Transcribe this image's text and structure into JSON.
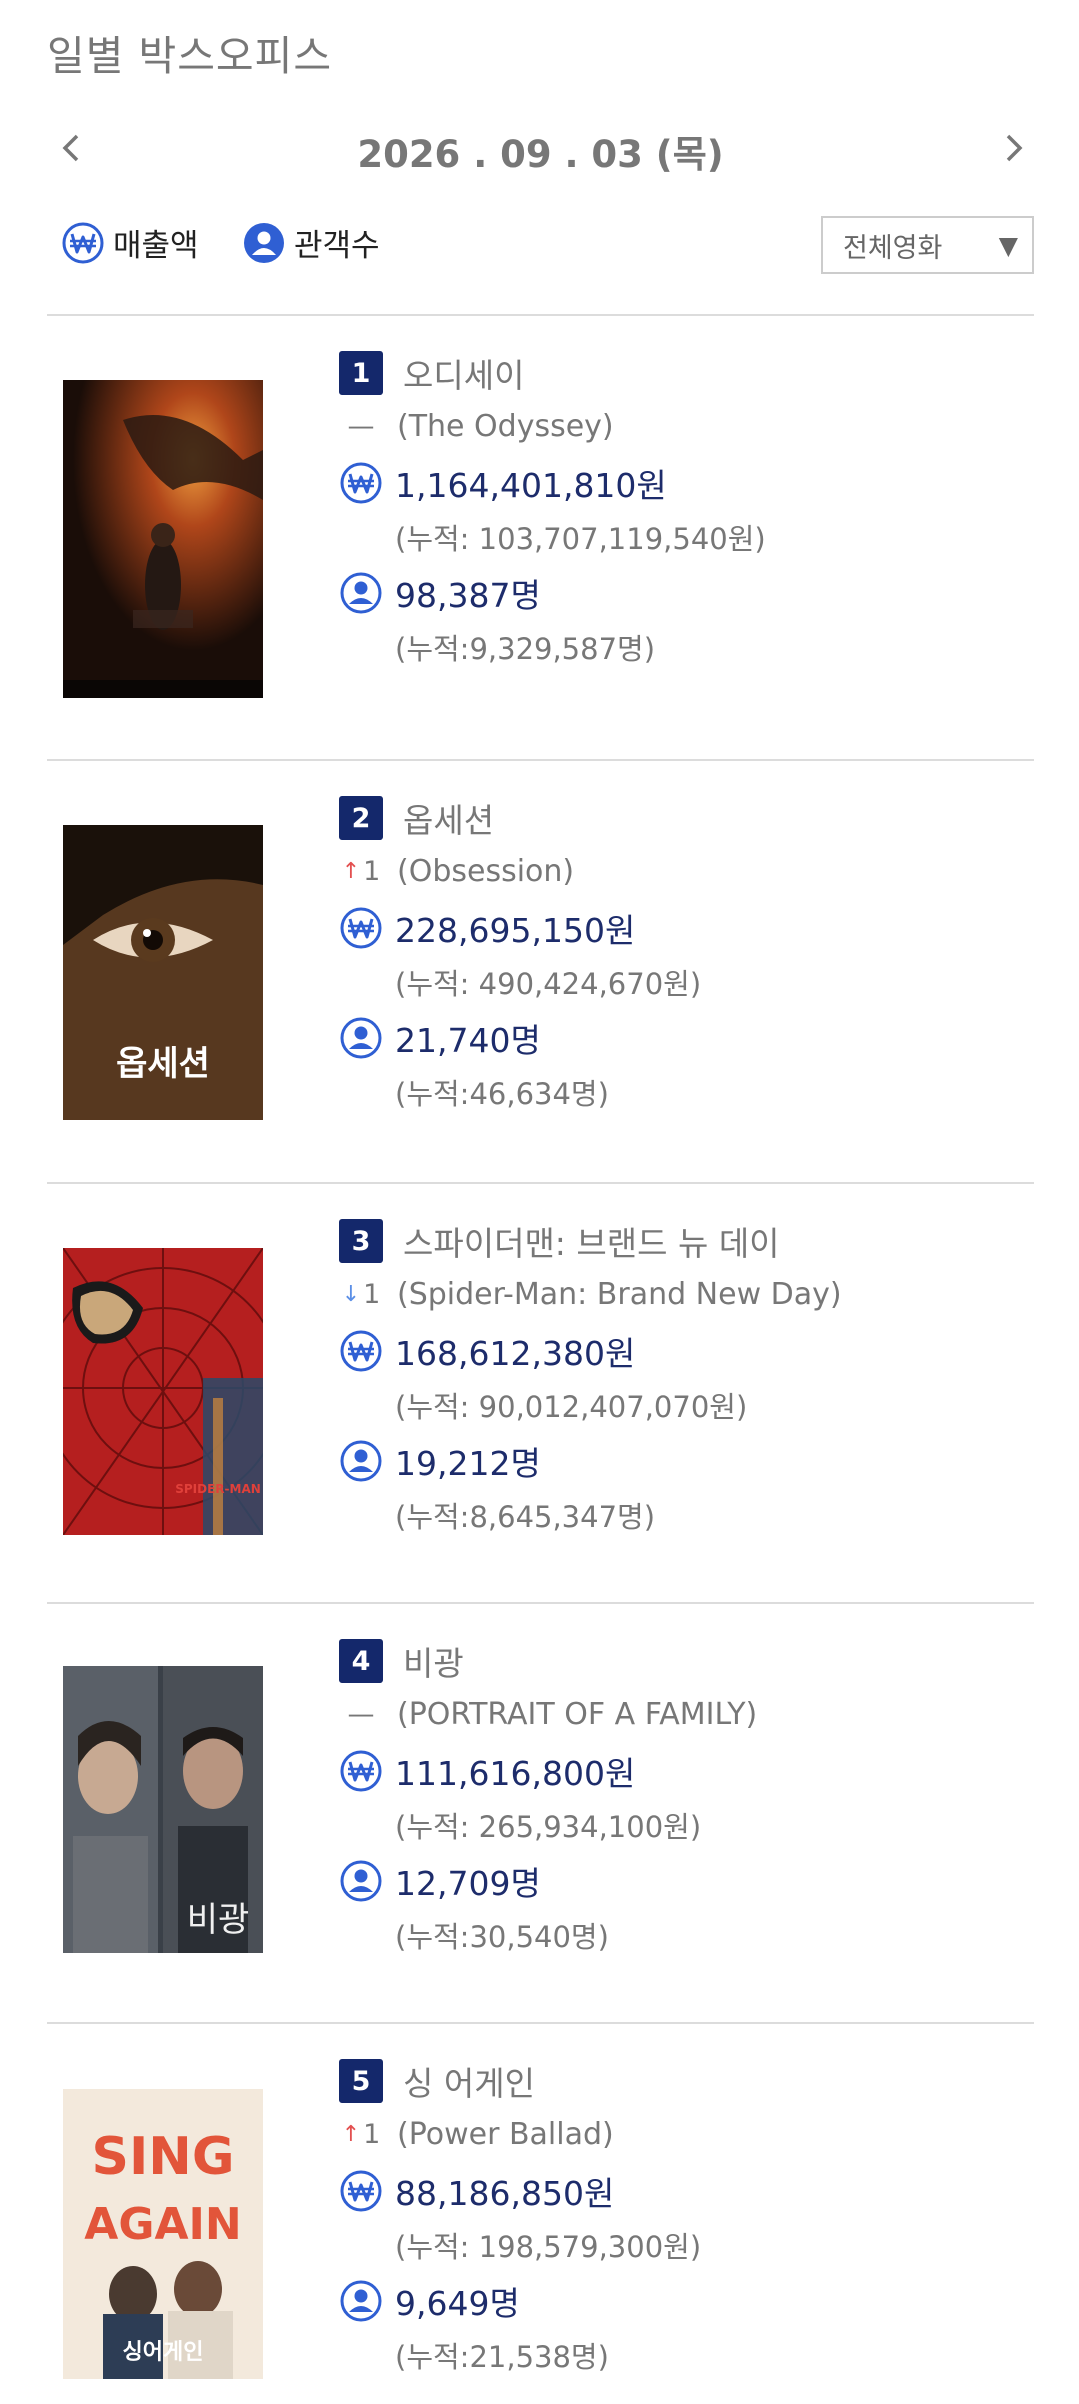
{
  "page": {
    "title": "일별 박스오피스"
  },
  "date_nav": {
    "date": "2026 . 09 . 03  (목)"
  },
  "sort": {
    "sales_label": "매출액",
    "audience_label": "관객수"
  },
  "filter": {
    "selected": "전체영화"
  },
  "colors": {
    "navy": "#14286b",
    "icon_blue": "#2f5fd3",
    "up": "#e35050",
    "down": "#5b8fe6"
  },
  "movies": [
    {
      "rank": "1",
      "title_ko": "오디세이",
      "change": "—",
      "title_en": "(The Odyssey)",
      "sales": "1,164,401,810원",
      "sales_cum": "(누적: 103,707,119,540원)",
      "audience": "98,387명",
      "audience_cum": "(누적:9,329,587명)"
    },
    {
      "rank": "2",
      "title_ko": "옵세션",
      "change_arrow": "↑",
      "change": "1",
      "title_en": "(Obsession)",
      "sales": "228,695,150원",
      "sales_cum": "(누적: 490,424,670원)",
      "audience": "21,740명",
      "audience_cum": "(누적:46,634명)",
      "poster_text": "옵세션"
    },
    {
      "rank": "3",
      "title_ko": "스파이더맨: 브랜드 뉴 데이",
      "change_arrow": "↓",
      "change": "1",
      "title_en": "(Spider-Man: Brand New Day)",
      "sales": "168,612,380원",
      "sales_cum": "(누적: 90,012,407,070원)",
      "audience": "19,212명",
      "audience_cum": "(누적:8,645,347명)"
    },
    {
      "rank": "4",
      "title_ko": "비광",
      "change": "—",
      "title_en": "(PORTRAIT OF A FAMILY)",
      "sales": "111,616,800원",
      "sales_cum": "(누적: 265,934,100원)",
      "audience": "12,709명",
      "audience_cum": "(누적:30,540명)",
      "poster_text": "비광"
    },
    {
      "rank": "5",
      "title_ko": "싱 어게인",
      "change_arrow": "↑",
      "change": "1",
      "title_en": "(Power Ballad)",
      "sales": "88,186,850원",
      "sales_cum": "(누적: 198,579,300원)",
      "audience": "9,649명",
      "audience_cum": "(누적:21,538명)",
      "poster_text_1": "SING",
      "poster_text_2": "AGAIN",
      "poster_text_3": "싱어게인"
    }
  ]
}
